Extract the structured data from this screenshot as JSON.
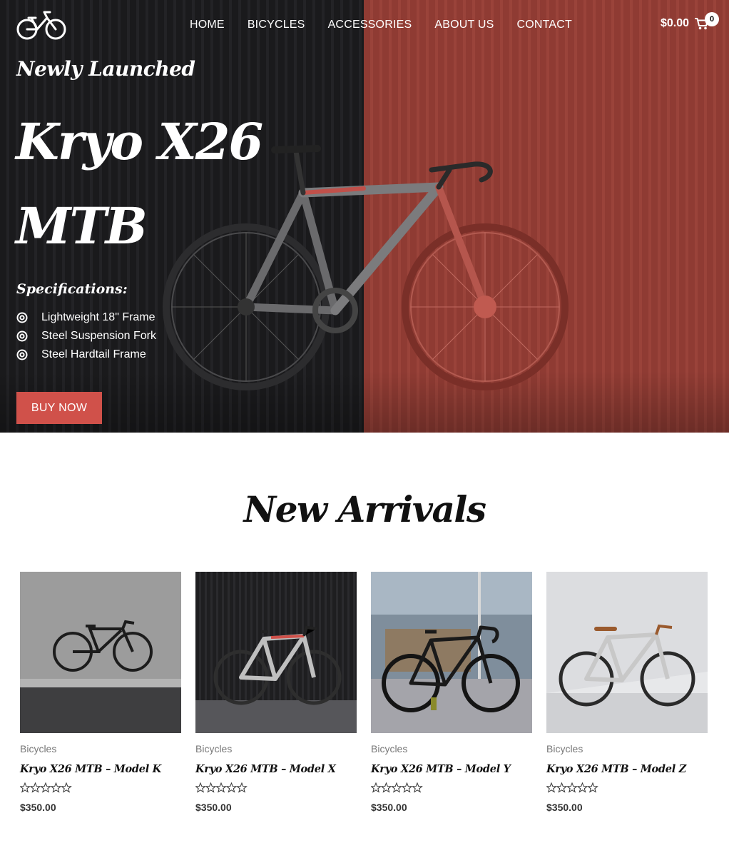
{
  "header": {
    "nav": [
      "HOME",
      "BICYCLES",
      "ACCESSORIES",
      "ABOUT US",
      "CONTACT"
    ],
    "cart_total": "$0.00",
    "cart_count": "0"
  },
  "hero": {
    "eyebrow": "Newly Launched",
    "title": "Kryo X26 MTB",
    "specs_title": "Specifications:",
    "specs": [
      "Lightweight 18\" Frame",
      "Steel Suspension Fork",
      "Steel Hardtail Frame"
    ],
    "button": "BUY NOW"
  },
  "arrivals": {
    "title": "New Arrivals",
    "products": [
      {
        "category": "Bicycles",
        "name": "Kryo X26 MTB – Model K",
        "price": "$350.00",
        "rating": 0
      },
      {
        "category": "Bicycles",
        "name": "Kryo X26 MTB – Model X",
        "price": "$350.00",
        "rating": 0
      },
      {
        "category": "Bicycles",
        "name": "Kryo X26 MTB – Model Y",
        "price": "$350.00",
        "rating": 0
      },
      {
        "category": "Bicycles",
        "name": "Kryo X26 MTB – Model Z",
        "price": "$350.00",
        "rating": 0
      }
    ]
  },
  "colors": {
    "accent": "#d0514a",
    "hero_right": "#933f36",
    "hero_left": "#1b1b1d"
  },
  "icons": {
    "logo": "bicycle-logo",
    "cart": "cart-icon",
    "spec_bullet": "target-icon",
    "rating": "star-outline-icon"
  }
}
